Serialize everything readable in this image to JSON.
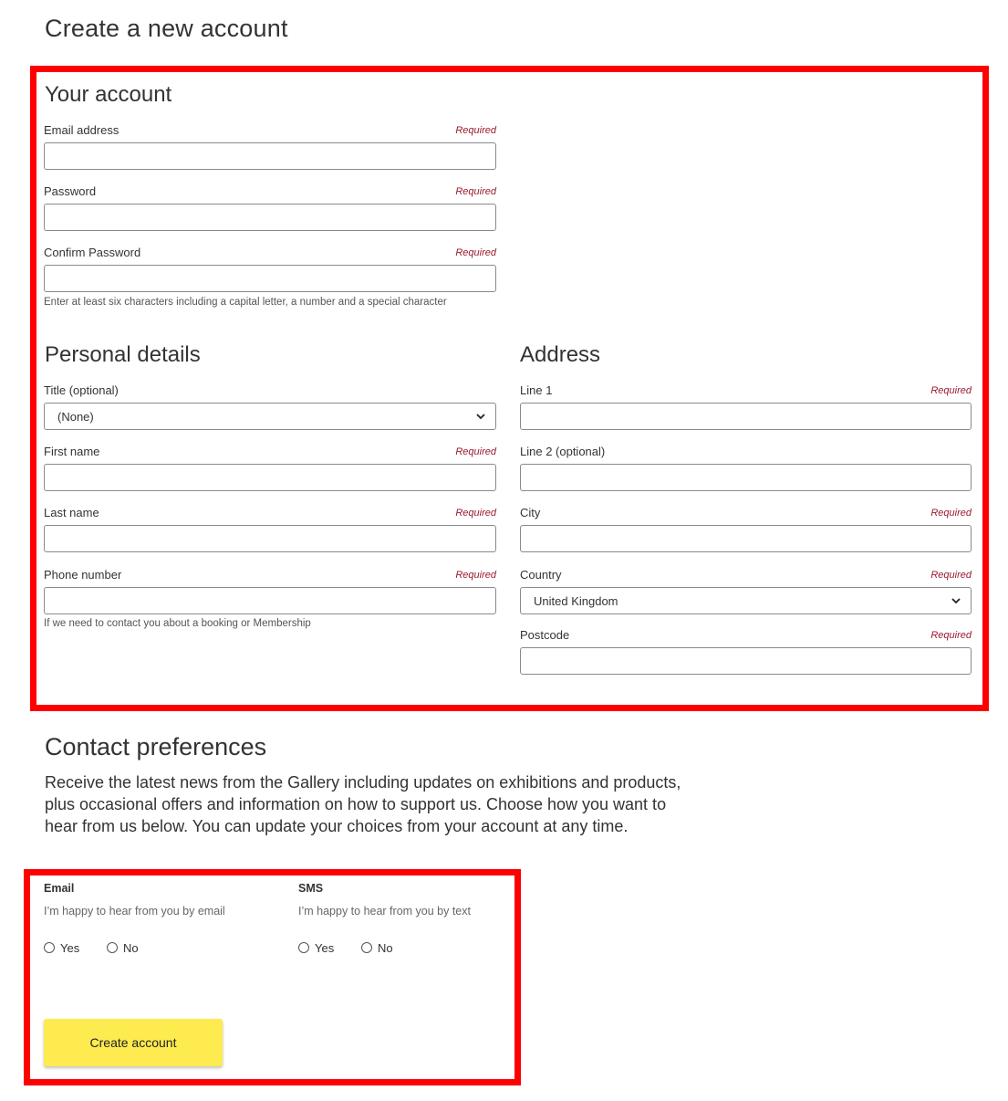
{
  "page": {
    "title": "Create a new account"
  },
  "required_label": "Required",
  "your_account": {
    "heading": "Your account",
    "email": {
      "label": "Email address",
      "value": ""
    },
    "password": {
      "label": "Password",
      "value": ""
    },
    "confirm_password": {
      "label": "Confirm Password",
      "value": ""
    },
    "password_hint": "Enter at least six characters including a capital letter, a number and a special character"
  },
  "personal_details": {
    "heading": "Personal details",
    "title_field": {
      "label": "Title (optional)",
      "selected": "(None)"
    },
    "first_name": {
      "label": "First name",
      "value": ""
    },
    "last_name": {
      "label": "Last name",
      "value": ""
    },
    "phone": {
      "label": "Phone number",
      "value": ""
    },
    "phone_hint": "If we need to contact you about a booking or Membership"
  },
  "address": {
    "heading": "Address",
    "line1": {
      "label": "Line 1",
      "value": ""
    },
    "line2": {
      "label": "Line 2 (optional)",
      "value": ""
    },
    "city": {
      "label": "City",
      "value": ""
    },
    "country": {
      "label": "Country",
      "selected": "United Kingdom"
    },
    "postcode": {
      "label": "Postcode",
      "value": ""
    }
  },
  "contact_preferences": {
    "heading": "Contact preferences",
    "intro": "Receive the latest news from the Gallery including updates on exhibitions and products, plus occasional offers and information on how to support us. Choose how you want to hear from us below. You can update your choices from your account at any time.",
    "email": {
      "title": "Email",
      "description": "I’m happy to hear from you by email",
      "yes": "Yes",
      "no": "No"
    },
    "sms": {
      "title": "SMS",
      "description": "I’m happy to hear from you by text",
      "yes": "Yes",
      "no": "No"
    }
  },
  "actions": {
    "create_account": "Create account"
  },
  "colors": {
    "highlight_border": "#ff0000",
    "required_text": "#9b1b30",
    "button_bg": "#fdeb4f"
  }
}
